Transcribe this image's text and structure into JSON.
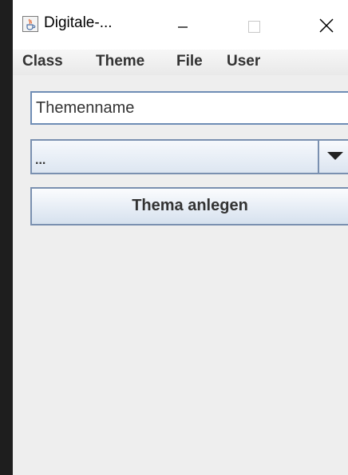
{
  "window": {
    "title": "Digitale-...",
    "accent_color": "#e8641e"
  },
  "titlebar": {
    "icon": "java-cup-icon",
    "minimize_icon": "minimize-icon",
    "maximize_icon": "maximize-icon",
    "close_icon": "close-icon"
  },
  "menubar": {
    "items": [
      {
        "label": "Class"
      },
      {
        "label": "Theme"
      },
      {
        "label": "File"
      },
      {
        "label": "User"
      }
    ]
  },
  "form": {
    "theme_name_value": "Themenname",
    "theme_select_value": "...",
    "create_button_label": "Thema anlegen"
  }
}
